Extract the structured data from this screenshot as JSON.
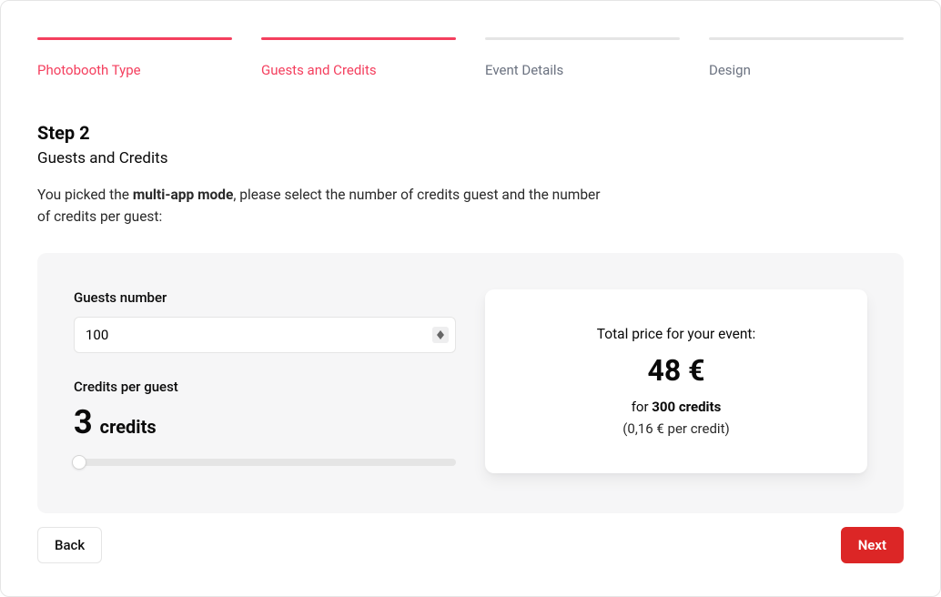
{
  "steps": {
    "items": [
      {
        "label": "Photobooth Type",
        "state": "done"
      },
      {
        "label": "Guests and Credits",
        "state": "active"
      },
      {
        "label": "Event Details",
        "state": "pending"
      },
      {
        "label": "Design",
        "state": "pending"
      }
    ]
  },
  "step_header": {
    "number": "Step 2",
    "name": "Guests and Credits"
  },
  "description": {
    "prefix": "You picked the ",
    "mode": "multi-app mode",
    "suffix": ", please select the number of credits guest and the number of credits per guest:"
  },
  "guests": {
    "label": "Guests number",
    "value": "100"
  },
  "credits_per_guest": {
    "label": "Credits per guest",
    "value": "3",
    "unit": "credits"
  },
  "price": {
    "title": "Total price for your event:",
    "amount": "48 €",
    "for_text": "for ",
    "credits_text": "300 credits",
    "per_credit": "(0,16 € per credit)"
  },
  "footer": {
    "back": "Back",
    "next": "Next"
  },
  "colors": {
    "accent": "#f43f5e",
    "primary_button": "#dc2626"
  }
}
